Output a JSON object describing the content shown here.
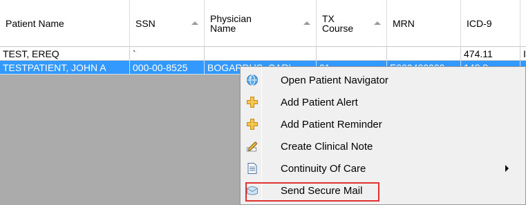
{
  "columns": [
    {
      "label": "Patient Name",
      "sort": false
    },
    {
      "label": "SSN",
      "sort": true
    },
    {
      "label": "Physician Name",
      "sort": true
    },
    {
      "label": "TX Course",
      "sort": true
    },
    {
      "label": "MRN",
      "sort": false
    },
    {
      "label": "ICD-9",
      "sort": false
    },
    {
      "label": "",
      "sort": false
    }
  ],
  "rows": [
    {
      "cells": [
        "TEST, EREQ",
        "`",
        "",
        "",
        "",
        "474.11",
        "I"
      ],
      "selected": false
    },
    {
      "cells": [
        "TESTPATIENT, JOHN A",
        "000-00-8525",
        "BOGARDUS, CARL",
        "01",
        "E000400000",
        "148.8",
        ""
      ],
      "selected": true
    }
  ],
  "context_menu": {
    "items": [
      {
        "label": "Open Patient Navigator",
        "icon": "globe-icon",
        "submenu": false,
        "highlighted": false
      },
      {
        "label": "Add Patient Alert",
        "icon": "yellow-plus-icon",
        "submenu": false,
        "highlighted": false
      },
      {
        "label": "Add Patient Reminder",
        "icon": "yellow-plus-icon",
        "submenu": false,
        "highlighted": false
      },
      {
        "label": "Create Clinical Note",
        "icon": "pencil-note-icon",
        "submenu": false,
        "highlighted": false
      },
      {
        "label": "Continuity Of Care",
        "icon": "document-icon",
        "submenu": true,
        "highlighted": false
      },
      {
        "label": "Send Secure Mail",
        "icon": "mail-icon",
        "submenu": false,
        "highlighted": true
      }
    ]
  },
  "colors": {
    "selection": "#3399ff",
    "annotation": "#e03030",
    "grid_background": "#ababab"
  }
}
